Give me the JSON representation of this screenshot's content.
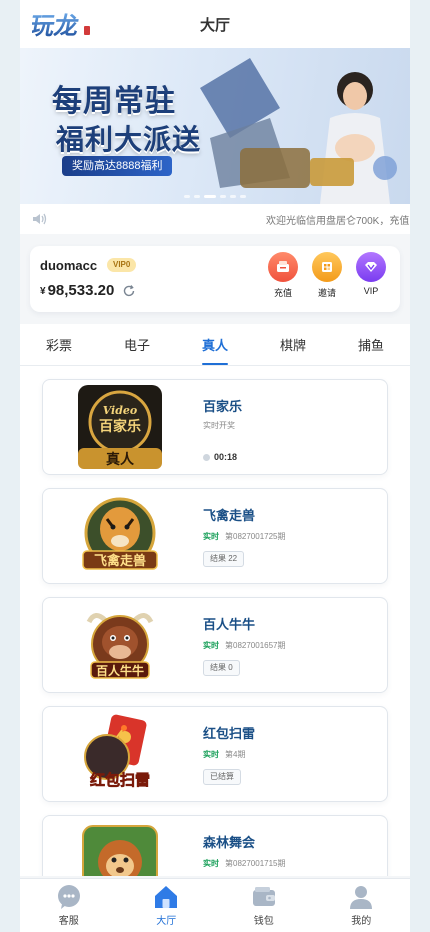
{
  "header": {
    "title": "大厅",
    "logo_text": "玩龙"
  },
  "banner": {
    "line1": "每周常驻",
    "line2": "福利大派送",
    "pill": "奖励高达8888福利",
    "dot_count": 6,
    "active_dot": 2
  },
  "notice": {
    "text": "欢迎光临信用盘居仑700K，充值"
  },
  "user": {
    "username": "duomacc",
    "vip": "VIP0",
    "currency": "¥",
    "balance": "98,533.20"
  },
  "actions": [
    {
      "label": "充值",
      "icon": "recharge-icon"
    },
    {
      "label": "邀请",
      "icon": "invite-icon"
    },
    {
      "label": "VIP",
      "icon": "vip-icon"
    }
  ],
  "tabs": [
    "彩票",
    "电子",
    "真人",
    "棋牌",
    "捕鱼"
  ],
  "active_tab": 2,
  "games": [
    {
      "name": "百家乐",
      "subtitle": "实时开奖",
      "timer": "00:18",
      "icon": "baccarat-game-icon"
    },
    {
      "name": "飞禽走兽",
      "live": "实时",
      "issue": "第0827001725期",
      "status": "结果 22",
      "icon": "birds-beasts-game-icon"
    },
    {
      "name": "百人牛牛",
      "live": "实时",
      "issue": "第0827001657期",
      "status": "结果 0",
      "icon": "bull-game-icon"
    },
    {
      "name": "红包扫雷",
      "live": "实时",
      "issue": "第4期",
      "status": "已结算",
      "icon": "red-packet-game-icon"
    },
    {
      "name": "森林舞会",
      "live": "实时",
      "issue": "第0827001715期",
      "icon": "forest-party-game-icon"
    }
  ],
  "nav": [
    {
      "label": "客服",
      "icon": "support-icon"
    },
    {
      "label": "大厅",
      "icon": "home-icon"
    },
    {
      "label": "钱包",
      "icon": "wallet-icon"
    },
    {
      "label": "我的",
      "icon": "profile-icon"
    }
  ],
  "colors": {
    "accent": "#1f6fd6",
    "title_blue": "#1a4f86",
    "live_green": "#1aa05a"
  }
}
